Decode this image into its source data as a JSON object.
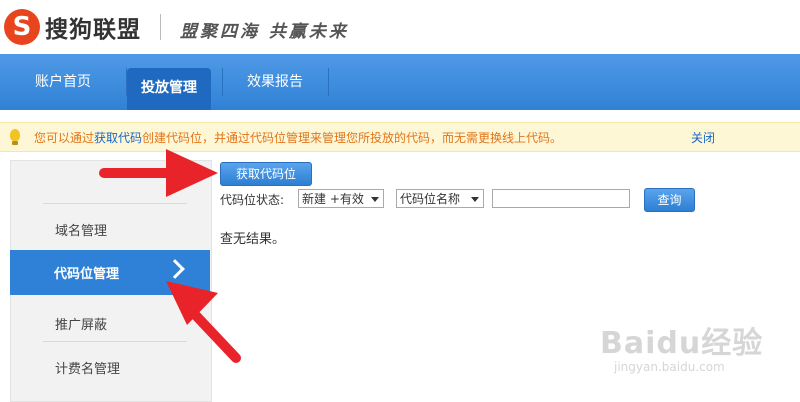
{
  "header": {
    "logo_icon": "sogou-s-icon",
    "logo_letter": "S",
    "logo_text": "搜狗联盟",
    "slogan": "盟聚四海 共赢未来"
  },
  "nav": {
    "items": [
      {
        "label": "账户首页",
        "active": false
      },
      {
        "label": "投放管理",
        "active": true
      },
      {
        "label": "效果报告",
        "active": false
      }
    ]
  },
  "notice": {
    "icon": "lightbulb-icon",
    "text_before": "您可以通过",
    "link": "获取代码",
    "text_after": "创建代码位，并通过代码位管理来管理您所投放的代码，而无需更换线上代码。",
    "close_label": "关闭"
  },
  "sidebar": {
    "items": [
      {
        "label": "域名管理",
        "active": false
      },
      {
        "label": "代码位管理",
        "active": true
      },
      {
        "label": "推广屏蔽",
        "active": false
      },
      {
        "label": "计费名管理",
        "active": false
      }
    ]
  },
  "main": {
    "get_code_button": "获取代码位",
    "status_label": "代码位状态:",
    "status_select": "新建 +有效",
    "field_select": "代码位名称",
    "search_value": "",
    "query_button": "查询",
    "no_result": "查无结果。"
  },
  "watermark": {
    "main": "Baidu经验",
    "sub": "jingyan.baidu.com"
  },
  "colors": {
    "nav_blue": "#3081d6",
    "active_blue": "#1f69c0",
    "notice_text": "#e0761c",
    "link_blue": "#1a66c4",
    "arrow_red": "#e8242a"
  }
}
